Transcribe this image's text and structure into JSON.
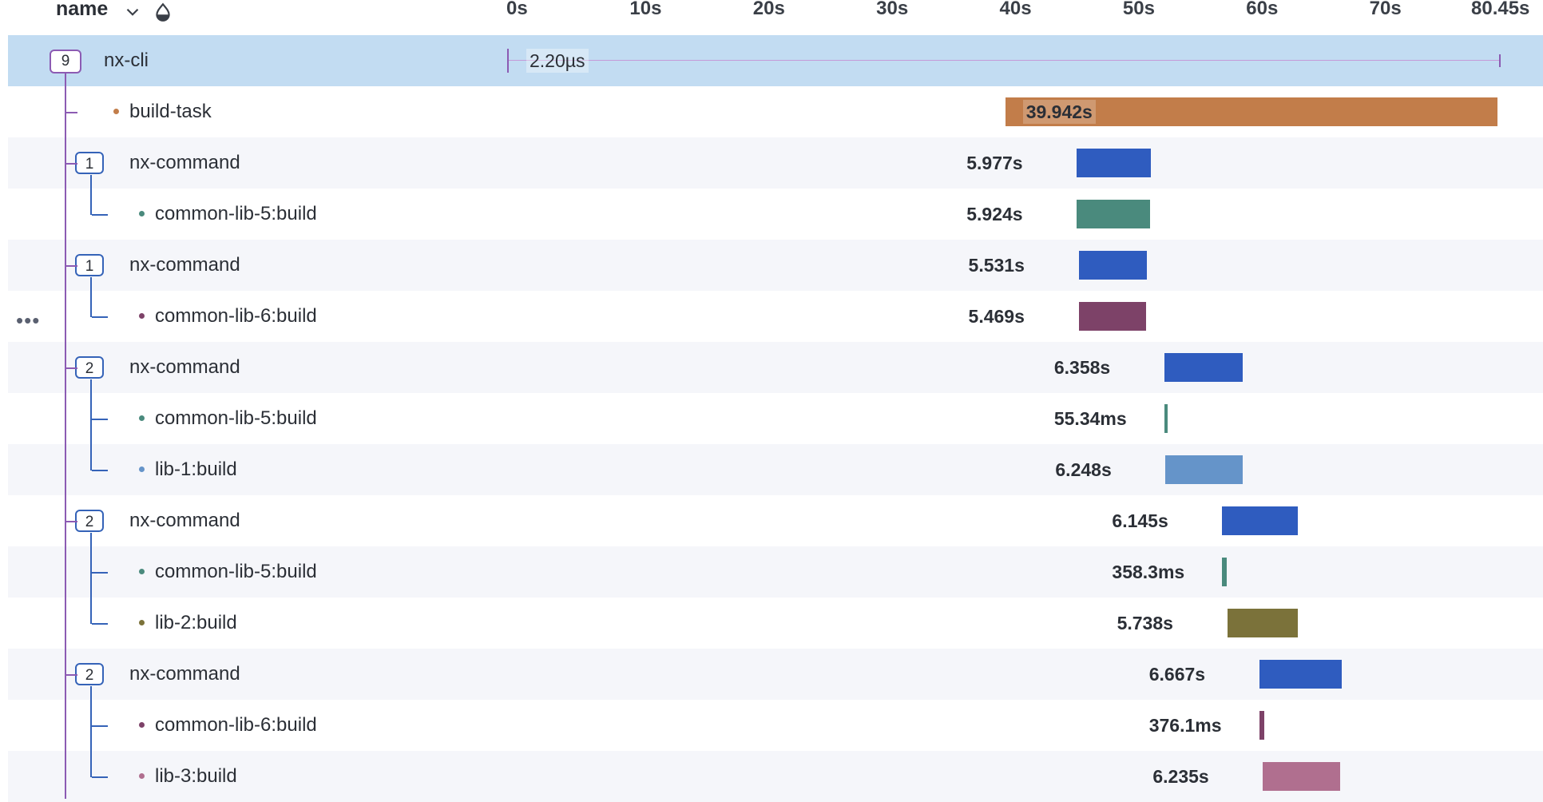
{
  "header": {
    "name_label": "name",
    "sort_icon": "chevron-down-icon",
    "color_icon": "drop-icon",
    "ticks": [
      "0s",
      "10s",
      "20s",
      "30s",
      "40s",
      "50s",
      "60s",
      "70s",
      "80.45s"
    ]
  },
  "rows": [
    {
      "label": "nx-cli",
      "count": "9",
      "duration": "2.20µs",
      "color": "#8c5bb3",
      "start_s": 0,
      "dur_s": 2.2e-06
    },
    {
      "label": "build-task",
      "duration": "39.942s",
      "color": "#c27d4a",
      "start_s": 40.4,
      "dur_s": 39.942
    },
    {
      "label": "nx-command",
      "count": "1",
      "duration": "5.977s",
      "color": "#2f5cbf",
      "start_s": 46.2,
      "dur_s": 5.977
    },
    {
      "label": "common-lib-5:build",
      "duration": "5.924s",
      "color": "#4a8a7d",
      "start_s": 46.2,
      "dur_s": 5.924
    },
    {
      "label": "nx-command",
      "count": "1",
      "duration": "5.531s",
      "color": "#2f5cbf",
      "start_s": 46.35,
      "dur_s": 5.531
    },
    {
      "label": "common-lib-6:build",
      "duration": "5.469s",
      "color": "#7d4268",
      "start_s": 46.35,
      "dur_s": 5.469
    },
    {
      "label": "nx-command",
      "count": "2",
      "duration": "6.358s",
      "color": "#2f5cbf",
      "start_s": 53.3,
      "dur_s": 6.358
    },
    {
      "label": "common-lib-5:build",
      "duration": "55.34ms",
      "color": "#4a8a7d",
      "start_s": 53.3,
      "dur_s": 0.05534
    },
    {
      "label": "lib-1:build",
      "duration": "6.248s",
      "color": "#6594c9",
      "start_s": 53.4,
      "dur_s": 6.248
    },
    {
      "label": "nx-command",
      "count": "2",
      "duration": "6.145s",
      "color": "#2f5cbf",
      "start_s": 58.0,
      "dur_s": 6.145
    },
    {
      "label": "common-lib-5:build",
      "duration": "358.3ms",
      "color": "#4a8a7d",
      "start_s": 58.0,
      "dur_s": 0.3583
    },
    {
      "label": "lib-2:build",
      "duration": "5.738s",
      "color": "#7b723a",
      "start_s": 58.4,
      "dur_s": 5.738
    },
    {
      "label": "nx-command",
      "count": "2",
      "duration": "6.667s",
      "color": "#2f5cbf",
      "start_s": 61.0,
      "dur_s": 6.667
    },
    {
      "label": "common-lib-6:build",
      "duration": "376.1ms",
      "color": "#7d4268",
      "start_s": 61.0,
      "dur_s": 0.3761
    },
    {
      "label": "lib-3:build",
      "duration": "6.235s",
      "color": "#b06f8f",
      "start_s": 61.3,
      "dur_s": 6.235
    }
  ]
}
